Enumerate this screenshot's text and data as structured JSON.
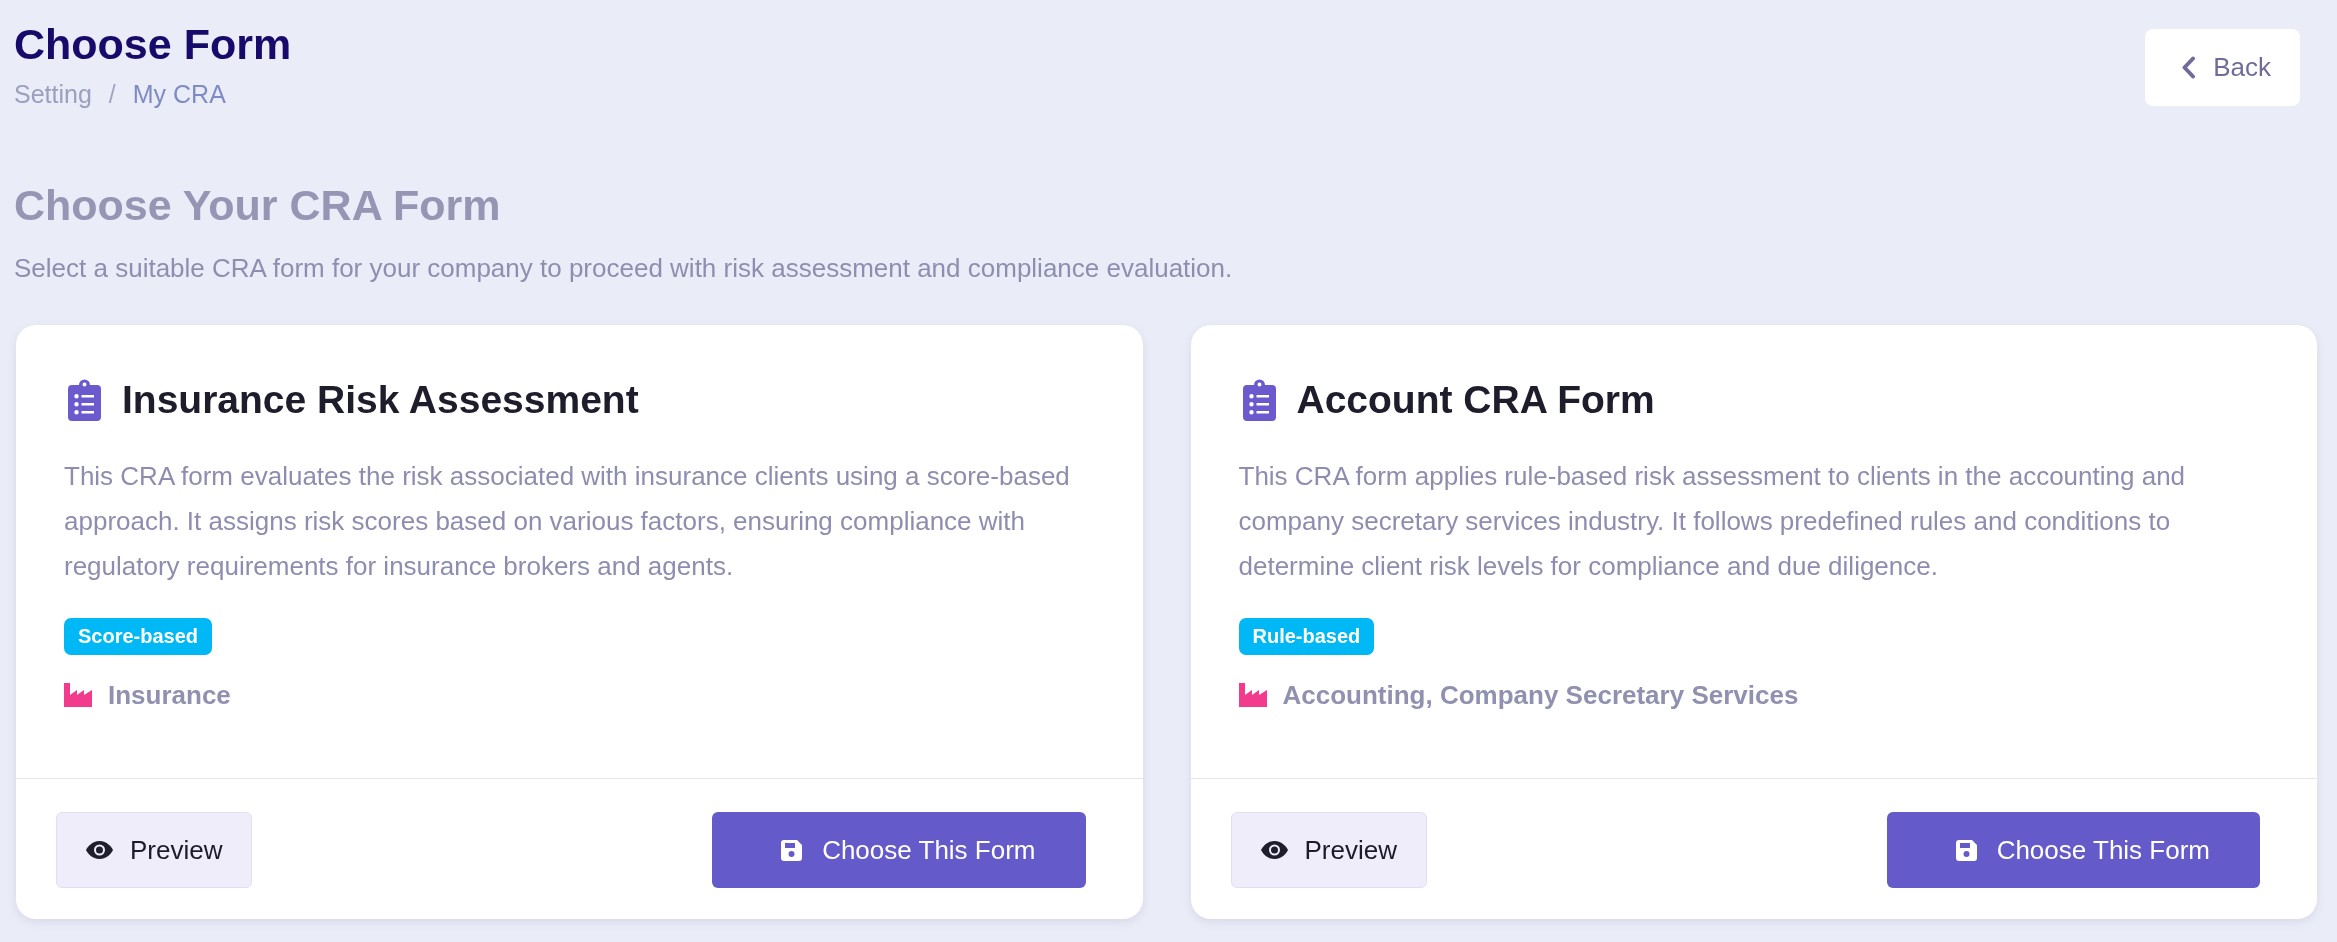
{
  "header": {
    "title": "Choose Form",
    "breadcrumb": {
      "items": [
        {
          "label": "Setting",
          "current": false
        },
        {
          "label": "My CRA",
          "current": true
        }
      ],
      "separator": "/"
    },
    "back_button": {
      "label": "Back"
    }
  },
  "intro": {
    "heading": "Choose Your CRA Form",
    "description": "Select a suitable CRA form for your company to proceed with risk assessment and compliance evaluation."
  },
  "forms": [
    {
      "title": "Insurance Risk Assessment",
      "description": "This CRA form evaluates the risk associated with insurance clients using a score-based approach. It assigns risk scores based on various factors, ensuring compliance with regulatory requirements for insurance brokers and agents.",
      "tag": "Score-based",
      "industry": "Insurance",
      "actions": [
        {
          "kind": "preview",
          "label": "Preview"
        },
        {
          "kind": "choose",
          "label": "Choose This Form"
        }
      ]
    },
    {
      "title": "Account CRA Form",
      "description": "This CRA form applies rule-based risk assessment to clients in the accounting and company secretary services industry. It follows predefined rules and conditions to determine client risk levels for compliance and due diligence.",
      "tag": "Rule-based",
      "industry": "Accounting, Company Secretary Services",
      "actions": [
        {
          "kind": "preview",
          "label": "Preview"
        },
        {
          "kind": "choose",
          "label": "Choose This Form"
        }
      ]
    }
  ]
}
